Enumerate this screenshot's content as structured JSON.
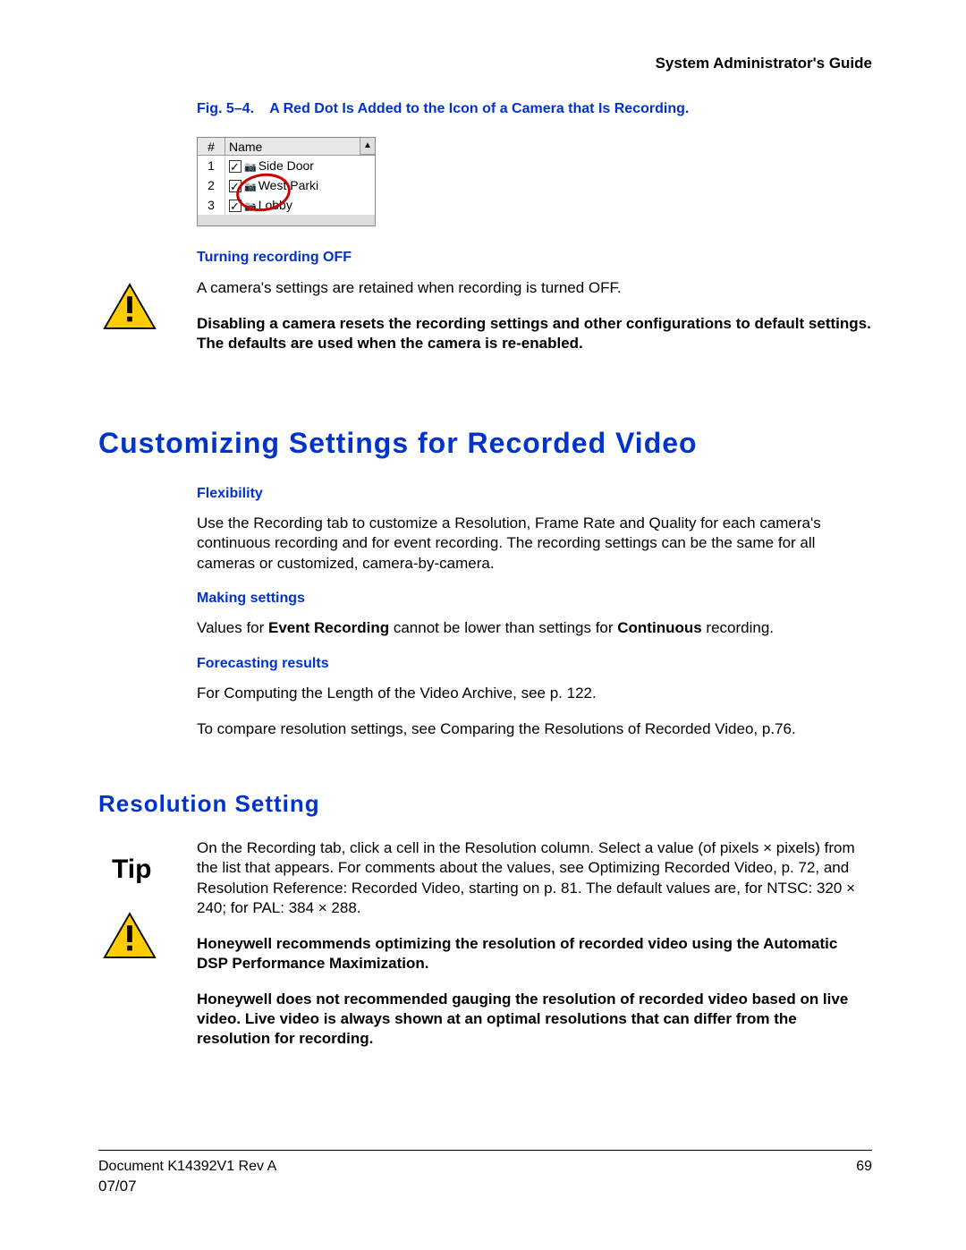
{
  "header": {
    "title": "System Administrator's Guide"
  },
  "figure": {
    "caption_prefix": "Fig. 5–4.",
    "caption_text": "A Red Dot Is Added to the Icon of a Camera that Is Recording.",
    "col_hash": "#",
    "col_name": "Name",
    "rows": [
      {
        "n": "1",
        "label": "Side Door"
      },
      {
        "n": "2",
        "label": "West Parki"
      },
      {
        "n": "3",
        "label": "Lobby"
      }
    ]
  },
  "section1": {
    "sub1": "Turning recording OFF",
    "p1": "A camera's settings are retained when recording is turned OFF.",
    "warn": "Disabling a camera resets the recording settings and other configurations to default settings. The defaults are used when the camera is re-enabled."
  },
  "h1": "Customizing Settings for Recorded Video",
  "section2": {
    "sub1": "Flexibility",
    "p1": "Use the Recording tab to customize a Resolution, Frame Rate and Quality for each camera's continuous recording and for event recording. The recording settings can be the same for all cameras or customized, camera-by-camera.",
    "sub2": "Making settings",
    "p2a": "Values for ",
    "p2b": "Event Recording",
    "p2c": " cannot be lower than settings for ",
    "p2d": "Continuous",
    "p2e": " recording.",
    "sub3": "Forecasting results",
    "p3": "For Computing the Length of the Video Archive, see p. 122.",
    "p4": "To compare resolution settings, see Comparing the Resolutions of Recorded Video, p.76."
  },
  "h2": "Resolution Setting",
  "section3": {
    "p1": "On the Recording tab, click a cell in the Resolution column. Select a value (of pixels × pixels) from the list that appears. For comments about the values, see Optimizing Recorded Video, p. 72, and Resolution Reference: Recorded Video, starting on p. 81. The default values are, for NTSC: 320 × 240; for PAL: 384 × 288.",
    "tip_label": "Tip",
    "tip": "Honeywell recommends optimizing the resolution of recorded video using the Automatic DSP Performance Maximization.",
    "warn": "Honeywell does not recommended gauging the resolution of recorded video based on live video. Live video is always shown at an optimal resolutions that can differ from the resolution for recording."
  },
  "footer": {
    "doc": "Document K14392V1 Rev A",
    "date": "07/07",
    "page": "69"
  }
}
